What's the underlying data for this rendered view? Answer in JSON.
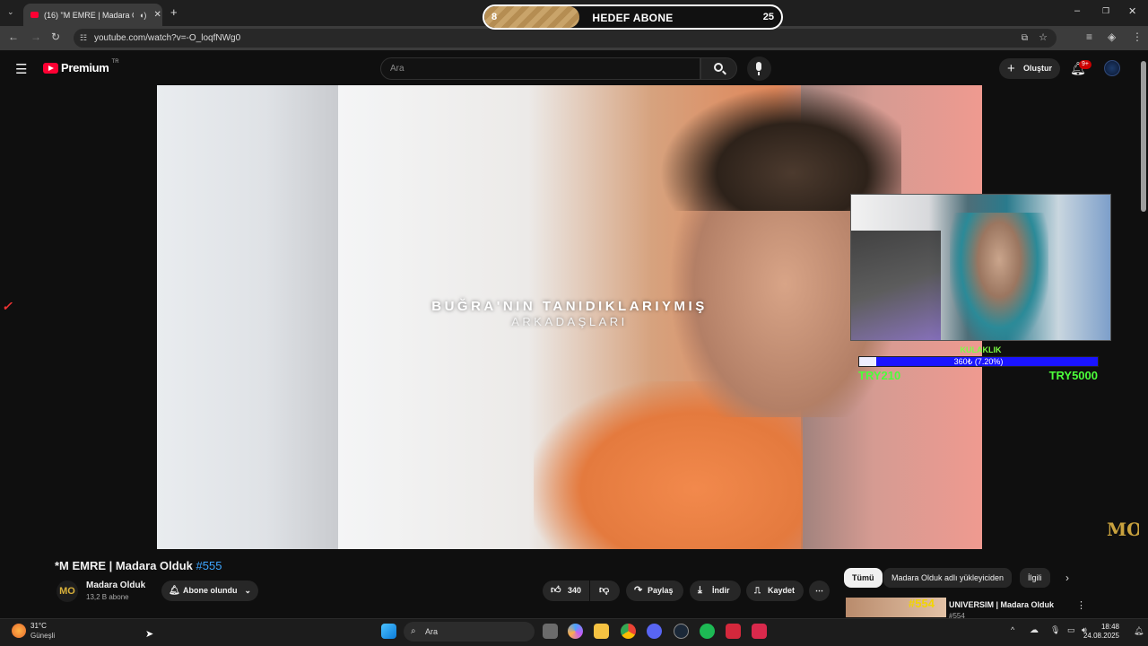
{
  "browser": {
    "tab_title": "(16) \"M EMRE | Madara Old",
    "url": "youtube.com/watch?v=-O_loqfNWg0"
  },
  "stream_overlay": {
    "goal_current": "8",
    "goal_title": "HEDEF ABONE",
    "goal_target": "25",
    "goal_progress": 0.32,
    "donation_label": "KULAKLIK",
    "donation_progress_text": "360₺ (7.20%)",
    "donation_progress": 0.072,
    "donation_min": "TRY210",
    "donation_max": "TRY5000",
    "watermark": "MO"
  },
  "youtube_header": {
    "logo": "Premium",
    "region": "TR",
    "search_placeholder": "Ara",
    "create_label": "Oluştur",
    "notifications_badge": "9+"
  },
  "video": {
    "subtitle_line1": "BUĞRA'NIN TANIDIKLARIYMIŞ",
    "subtitle_line2": "ARKADAŞLARI",
    "title": "*M EMRE | Madara Olduk",
    "title_tag": "#555"
  },
  "channel": {
    "avatar_text": "MO",
    "name": "Madara Olduk",
    "subscribers": "13,2 B abone",
    "subscribed_label": "Abone olundu"
  },
  "actions": {
    "likes": "340",
    "share": "Paylaş",
    "download": "İndir",
    "save": "Kaydet"
  },
  "chips": [
    "Tümü",
    "Madara Olduk adlı yükleyiciden",
    "İlgili"
  ],
  "recommendation": {
    "badge": "#554",
    "title": "UNIVERSIM | Madara Olduk",
    "subtitle": "#554"
  },
  "taskbar": {
    "temperature": "31°C",
    "weather": "Güneşli",
    "search": "Ara",
    "time": "18:48",
    "date": "24.08.2025"
  },
  "colors": {
    "youtube_red": "#ff0033",
    "link_blue": "#3ea6ff",
    "donation_green": "#4cff3a",
    "donation_bar_blue": "#1a14ff"
  }
}
